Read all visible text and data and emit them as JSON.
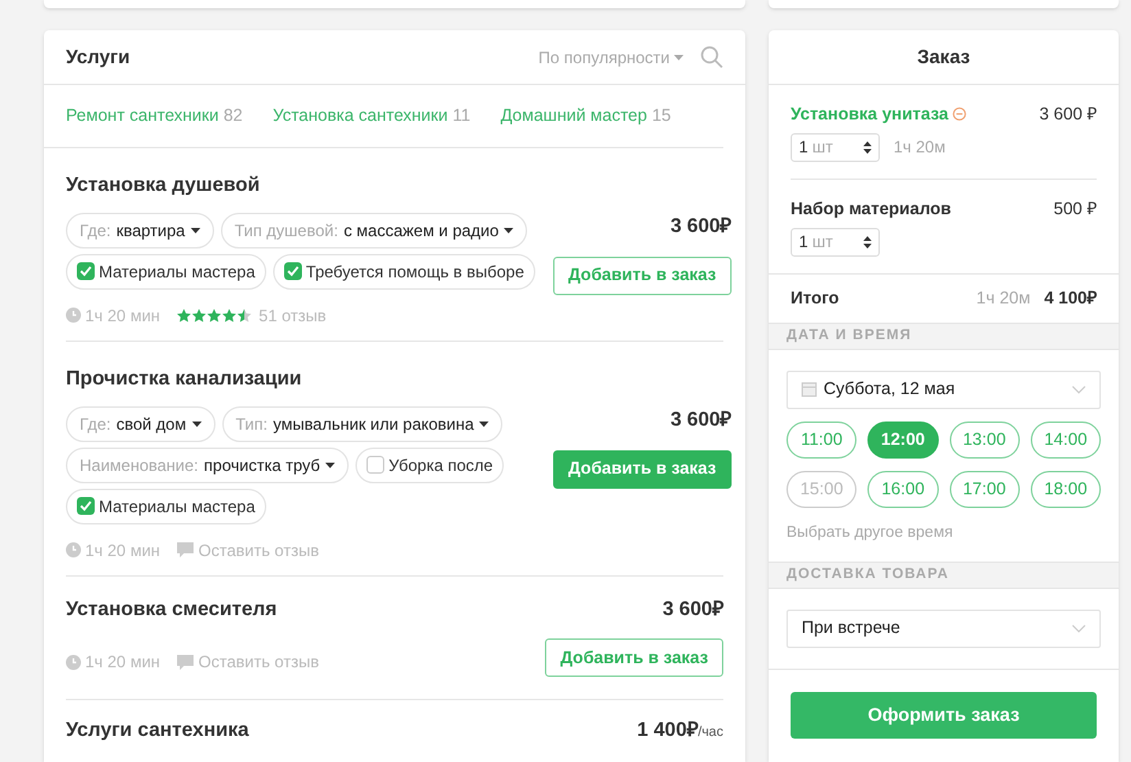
{
  "services_panel": {
    "title": "Услуги",
    "sort": "По популярности"
  },
  "categories": [
    {
      "label": "Ремонт сантехники",
      "count": "82"
    },
    {
      "label": "Установка сантехники",
      "count": "11"
    },
    {
      "label": "Домашний мастер",
      "count": "15"
    }
  ],
  "services": [
    {
      "title": "Установка душевой",
      "price": "3 600₽",
      "button": "Добавить в заказ",
      "hovered": false,
      "options": [
        {
          "kind": "select",
          "label": "Где:",
          "value": "квартира"
        },
        {
          "kind": "select",
          "label": "Тип душевой:",
          "value": "с массажем и радио"
        },
        {
          "kind": "checkbox",
          "label": "Материалы мастера",
          "checked": true
        },
        {
          "kind": "checkbox",
          "label": "Требуется помощь в выборе",
          "checked": true
        }
      ],
      "duration": "1ч 20 мин",
      "stars": 4.5,
      "reviews": "51 отзыв"
    },
    {
      "title": "Прочистка канализации",
      "price": "3 600₽",
      "button": "Добавить в заказ",
      "hovered": true,
      "options": [
        {
          "kind": "select",
          "label": "Где:",
          "value": "свой дом"
        },
        {
          "kind": "select",
          "label": "Тип:",
          "value": "умывальник или раковина"
        },
        {
          "kind": "select",
          "label": "Наименование:",
          "value": "прочистка труб"
        },
        {
          "kind": "checkbox",
          "label": "Уборка после",
          "checked": false
        },
        {
          "kind": "checkbox",
          "label": "Материалы мастера",
          "checked": true
        }
      ],
      "duration": "1ч 20 мин",
      "review_link": "Оставить отзыв"
    },
    {
      "title": "Установка смесителя",
      "price": "3 600₽",
      "button": "Добавить в заказ",
      "hovered": false,
      "duration": "1ч 20 мин",
      "review_link": "Оставить отзыв"
    },
    {
      "title": "Услуги сантехника",
      "price": "1 400₽",
      "unit": "/час"
    }
  ],
  "order": {
    "title": "Заказ",
    "items": [
      {
        "name": "Установка унитаза",
        "link": true,
        "removable": true,
        "price": "3 600 ₽",
        "qty": "1",
        "unit": "шт",
        "duration": "1ч 20м"
      },
      {
        "name": "Набор материалов",
        "link": false,
        "removable": false,
        "price": "500 ₽",
        "qty": "1",
        "unit": "шт"
      }
    ],
    "total_label": "Итого",
    "total_duration": "1ч 20м",
    "total": "4 100₽",
    "datetime_heading": "ДАТА И ВРЕМЯ",
    "date": "Суббота, 12 мая",
    "slots": [
      {
        "time": "11:00",
        "selected": false,
        "disabled": false
      },
      {
        "time": "12:00",
        "selected": true,
        "disabled": false
      },
      {
        "time": "13:00",
        "selected": false,
        "disabled": false
      },
      {
        "time": "14:00",
        "selected": false,
        "disabled": false
      },
      {
        "time": "15:00",
        "selected": false,
        "disabled": true
      },
      {
        "time": "16:00",
        "selected": false,
        "disabled": false
      },
      {
        "time": "17:00",
        "selected": false,
        "disabled": false
      },
      {
        "time": "18:00",
        "selected": false,
        "disabled": false
      }
    ],
    "other_time": "Выбрать другое время",
    "delivery_heading": "ДОСТАВКА ТОВАРА",
    "delivery": "При встрече",
    "submit": "Оформить заказ"
  }
}
